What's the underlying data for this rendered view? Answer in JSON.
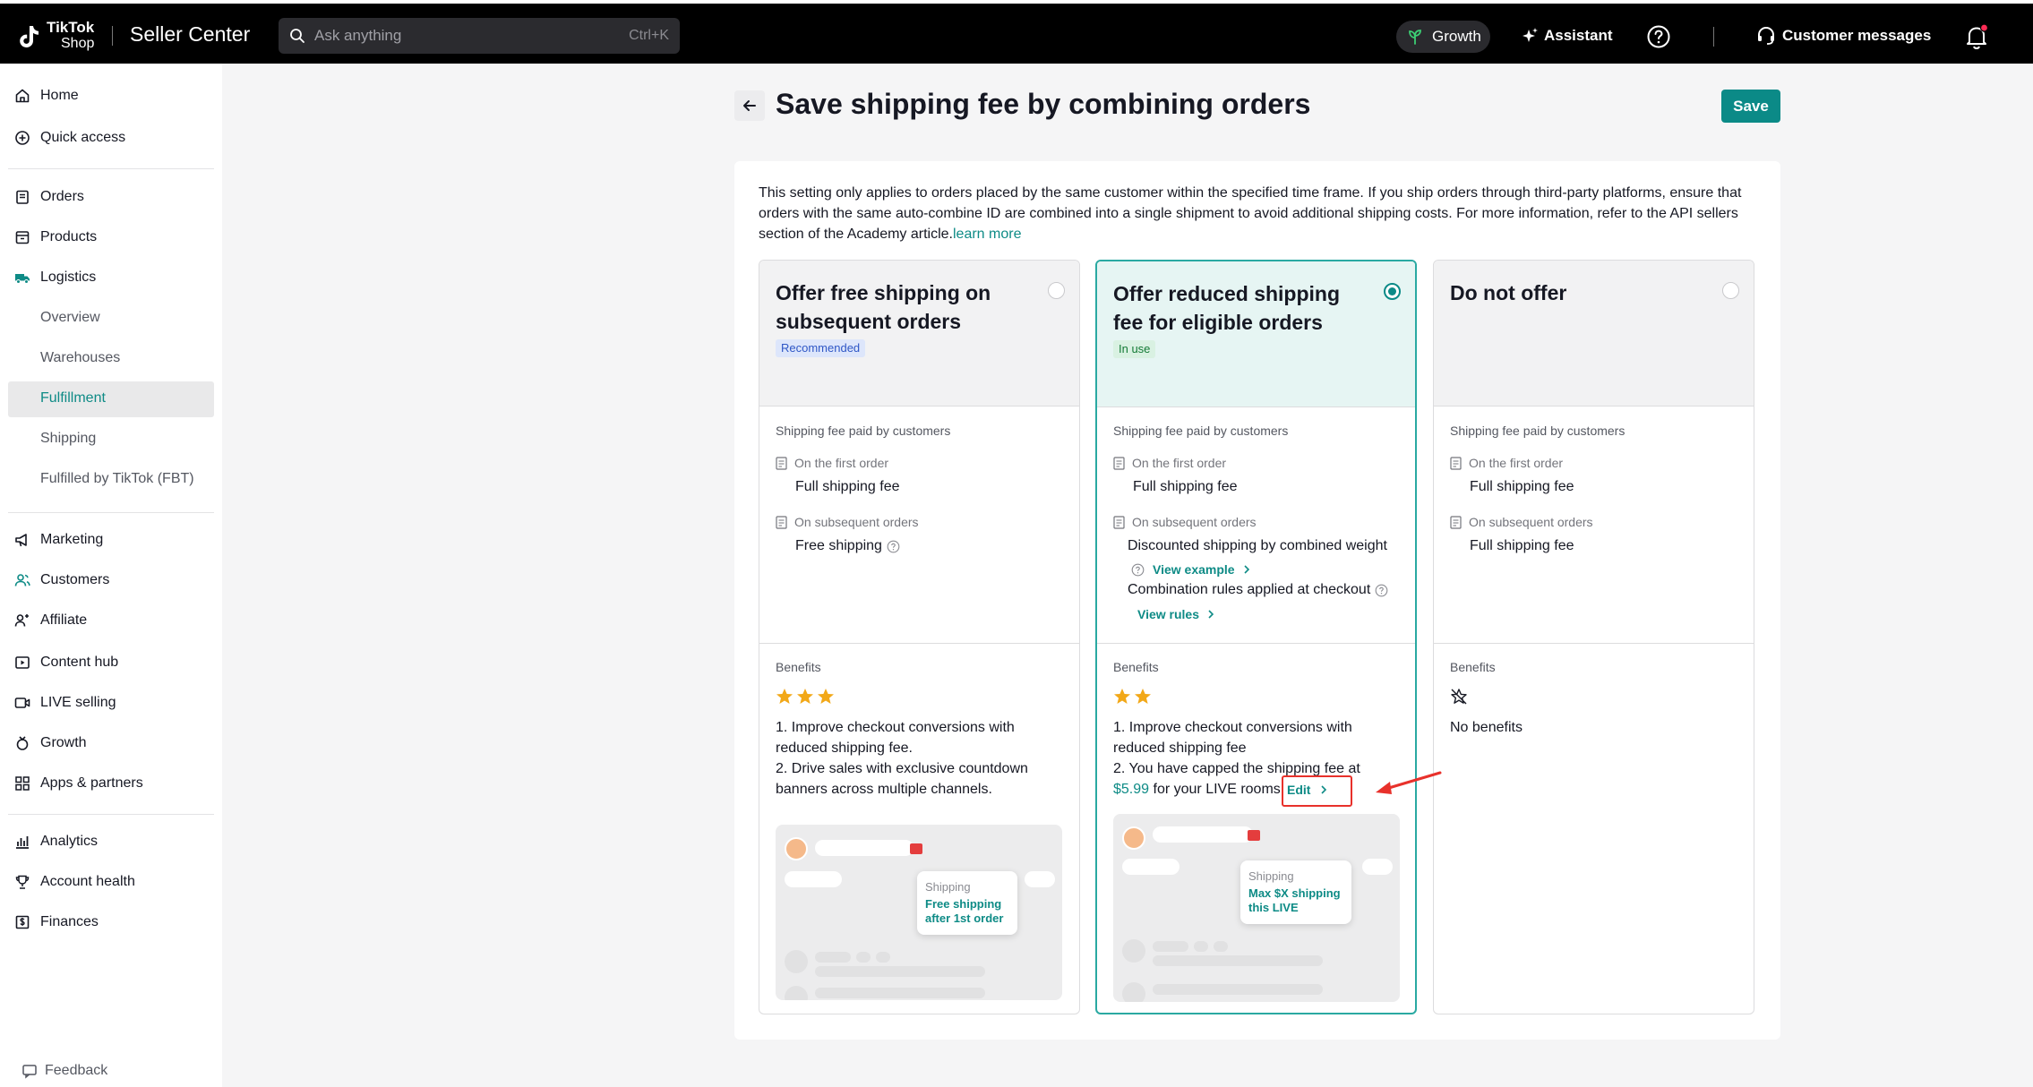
{
  "header": {
    "brand_line1": "TikTok",
    "brand_line2": "Shop",
    "app_title": "Seller Center",
    "search_placeholder": "Ask anything",
    "search_shortcut": "Ctrl+K",
    "growth_label": "Growth",
    "assistant_label": "Assistant",
    "customer_messages_label": "Customer messages"
  },
  "sidebar": {
    "top_items": [
      {
        "label": "Home",
        "icon": "home-icon"
      },
      {
        "label": "Quick access",
        "icon": "quick-access-icon"
      }
    ],
    "main_items": [
      {
        "label": "Orders",
        "icon": "orders-icon"
      },
      {
        "label": "Products",
        "icon": "products-icon"
      },
      {
        "label": "Logistics",
        "icon": "logistics-icon"
      }
    ],
    "logistics_sub": [
      "Overview",
      "Warehouses",
      "Fulfillment",
      "Shipping",
      "Fulfilled by TikTok (FBT)"
    ],
    "active_sub": "Fulfillment",
    "more_items": [
      {
        "label": "Marketing",
        "icon": "megaphone-icon"
      },
      {
        "label": "Customers",
        "icon": "customers-icon"
      },
      {
        "label": "Affiliate",
        "icon": "affiliate-icon"
      },
      {
        "label": "Content hub",
        "icon": "content-hub-icon"
      },
      {
        "label": "LIVE selling",
        "icon": "live-icon"
      },
      {
        "label": "Growth",
        "icon": "growth-icon"
      },
      {
        "label": "Apps & partners",
        "icon": "apps-icon"
      }
    ],
    "bottom_items": [
      {
        "label": "Analytics",
        "icon": "analytics-icon"
      },
      {
        "label": "Account health",
        "icon": "trophy-icon"
      },
      {
        "label": "Finances",
        "icon": "finances-icon"
      }
    ],
    "feedback_label": "Feedback"
  },
  "page": {
    "title": "Save shipping fee by combining orders",
    "save_label": "Save",
    "intro": "This setting only applies to orders placed by the same customer within the specified time frame. If you ship orders through third-party platforms, ensure that orders with the same auto-combine ID are combined into a single shipment to avoid additional shipping costs. For more information, refer to the API sellers section of the Academy article.",
    "learn_more": "learn more"
  },
  "cards": [
    {
      "title": "Offer free shipping on subsequent orders",
      "badge": "Recommended",
      "selected": false,
      "fee_label": "Shipping fee paid by customers",
      "first_label": "On the first order",
      "first_value": "Full shipping fee",
      "subsequent_label": "On subsequent orders",
      "subsequent_value": "Free shipping",
      "benefits_label": "Benefits",
      "stars": 3,
      "benefit_1": "1. Improve checkout conversions with reduced shipping fee.",
      "benefit_2": "2. Drive sales with exclusive countdown banners across multiple channels.",
      "preview_title": "Shipping",
      "preview_text": "Free shipping after 1st order"
    },
    {
      "title": "Offer reduced shipping fee for eligible orders",
      "badge": "In use",
      "selected": true,
      "fee_label": "Shipping fee paid by customers",
      "first_label": "On the first order",
      "first_value": "Full shipping fee",
      "subsequent_label": "On subsequent orders",
      "subsequent_value": "Discounted shipping by combined weight",
      "view_example": "View example",
      "combination_text": "Combination rules applied at checkout",
      "view_rules": "View rules",
      "benefits_label": "Benefits",
      "stars": 2,
      "benefit_1": "1. Improve checkout conversions with reduced shipping fee",
      "benefit_2a": "2. You have capped the shipping fee at",
      "price": "$5.99",
      "benefit_2b": "for your LIVE rooms",
      "edit_label": "Edit",
      "preview_title": "Shipping",
      "preview_text": "Max $X shipping this LIVE"
    },
    {
      "title": "Do not offer",
      "selected": false,
      "fee_label": "Shipping fee paid by customers",
      "first_label": "On the first order",
      "first_value": "Full shipping fee",
      "subsequent_label": "On subsequent orders",
      "subsequent_value": "Full shipping fee",
      "benefits_label": "Benefits",
      "stars": 0,
      "no_benefits": "No benefits"
    }
  ],
  "colors": {
    "accent": "#0b8a87",
    "star": "#f2a818",
    "annotation": "#e8312b"
  }
}
